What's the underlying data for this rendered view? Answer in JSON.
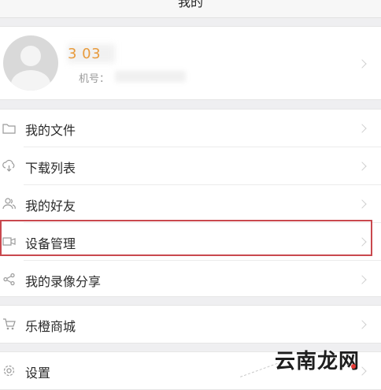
{
  "header": {
    "title": "我的"
  },
  "profile": {
    "username": "3        03",
    "phone_label": "机号："
  },
  "menu": {
    "group1": [
      {
        "label": "我的文件",
        "icon": "folder-icon"
      },
      {
        "label": "下载列表",
        "icon": "cloud-download-icon"
      },
      {
        "label": "我的好友",
        "icon": "friends-icon"
      },
      {
        "label": "设备管理",
        "icon": "camera-device-icon"
      },
      {
        "label": "我的录像分享",
        "icon": "share-icon"
      }
    ],
    "group2": [
      {
        "label": "乐橙商城",
        "icon": "cart-icon"
      }
    ],
    "group3": [
      {
        "label": "设置",
        "icon": "gear-icon"
      }
    ]
  },
  "watermark": {
    "text": "云南龙网"
  },
  "colors": {
    "username": "#e89b3d",
    "highlight_border": "#c9484e",
    "page_bg": "#efeff1"
  }
}
